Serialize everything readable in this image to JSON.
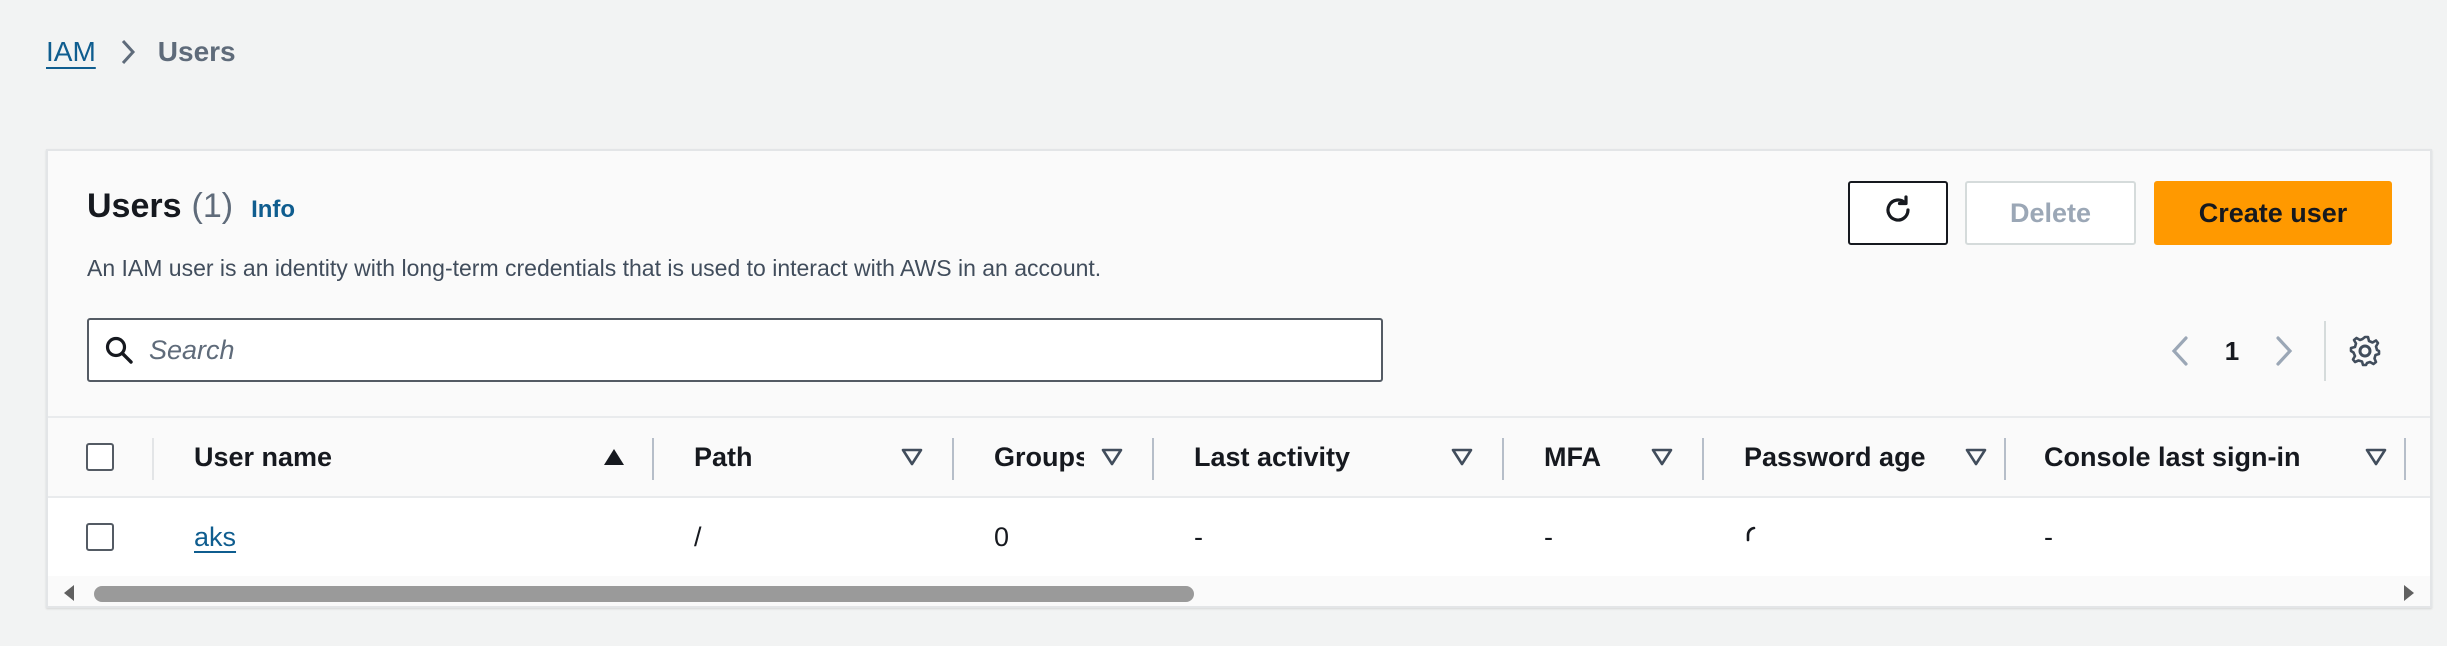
{
  "breadcrumb": {
    "root": "IAM",
    "current": "Users"
  },
  "panel": {
    "title": "Users",
    "count": "(1)",
    "info": "Info",
    "description": "An IAM user is an identity with long-term credentials that is used to interact with AWS in an account."
  },
  "actions": {
    "refresh_icon": "refresh-icon",
    "delete_label": "Delete",
    "create_label": "Create user"
  },
  "search": {
    "placeholder": "Search",
    "value": ""
  },
  "pagination": {
    "current_page": "1"
  },
  "table": {
    "columns": [
      {
        "label": "User name",
        "sort": "ascending"
      },
      {
        "label": "Path",
        "sort": "none"
      },
      {
        "label": "Groups",
        "sort": "none"
      },
      {
        "label": "Last activity",
        "sort": "none"
      },
      {
        "label": "MFA",
        "sort": "none"
      },
      {
        "label": "Password age",
        "sort": "none"
      },
      {
        "label": "Console last sign-in",
        "sort": "none"
      }
    ],
    "rows": [
      {
        "user_name": "aks",
        "path": "/",
        "groups": "0",
        "last_activity": "-",
        "mfa": "-",
        "password_age": "",
        "console_last_sign_in": "-"
      }
    ]
  },
  "colors": {
    "accent_orange": "#ff9900",
    "link_blue": "#0f5d8f",
    "text_dark": "#16191f",
    "text_muted": "#5f6b7a"
  }
}
